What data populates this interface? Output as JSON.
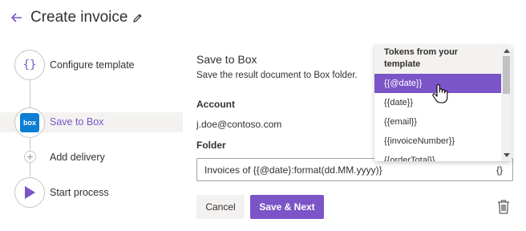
{
  "header": {
    "title": "Create invoice"
  },
  "steps": [
    {
      "label": "Configure template",
      "icon": "braces-icon"
    },
    {
      "label": "Save to Box",
      "icon": "box-logo"
    },
    {
      "label": "Add delivery",
      "icon": "plus-icon"
    },
    {
      "label": "Start process",
      "icon": "play-icon"
    }
  ],
  "main": {
    "title": "Save to Box",
    "description": "Save the result document to Box folder.",
    "account_label": "Account",
    "account_value": "j.doe@contoso.com",
    "folder_label": "Folder",
    "folder_value": "Invoices of {{@date}:format(dd.MM.yyyy)}",
    "token_button": "{}",
    "cancel_label": "Cancel",
    "next_label": "Save & Next"
  },
  "dropdown": {
    "header": "Tokens from your template",
    "items": [
      "{{@date}}",
      "{{date}}",
      "{{email}}",
      "{{invoiceNumber}}",
      "{{orderTotal}}"
    ],
    "selected": "{{@date}}"
  },
  "logo": {
    "box_text": "box"
  },
  "colors": {
    "accent": "#7B55C7",
    "box": "#0B7ED4"
  }
}
